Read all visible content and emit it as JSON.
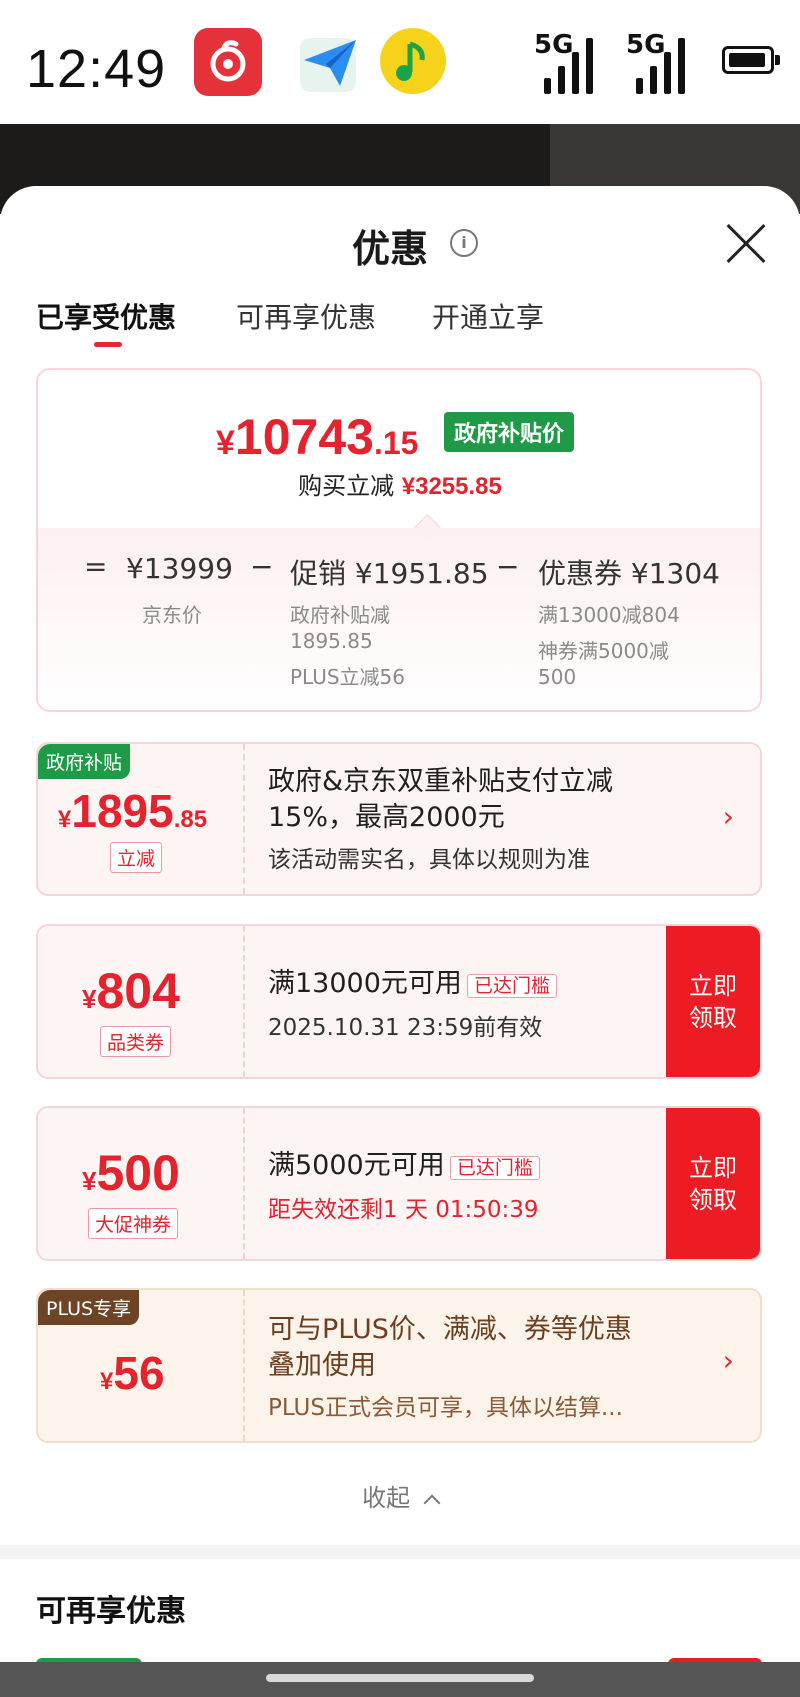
{
  "status_bar": {
    "time": "12:49",
    "network1": "5G",
    "network2": "5G"
  },
  "apps": [
    "netease-music-icon",
    "paper-plane-icon",
    "qq-music-icon"
  ],
  "sheet": {
    "title": "优惠",
    "tabs": [
      "已享受优惠",
      "可再享优惠",
      "开通立享"
    ],
    "active_tab": 0
  },
  "summary": {
    "yen": "¥",
    "price_int": "10743",
    "price_dec": ".15",
    "tag": "政府补贴价",
    "reduce_label": "购买立减",
    "reduce_amount": "¥3255.85",
    "eq": "=",
    "minus": "−",
    "jd_price": "¥13999",
    "jd_price_label": "京东价",
    "promo": "促销 ¥1951.85",
    "promo_detail1": "政府补贴减",
    "promo_detail2": "1895.85",
    "promo_detail3": "PLUS立减56",
    "coupon": "优惠券 ¥1304",
    "coupon_detail1": "满13000减804",
    "coupon_detail2": "神券满5000减",
    "coupon_detail3": "500"
  },
  "cards": [
    {
      "corner": "政府补贴",
      "yen": "¥",
      "amount": "1895",
      "amount_dec": ".85",
      "label": "立减",
      "line1": "政府&京东双重补贴支付立减",
      "line2": "15%，最高2000元",
      "line3": "该活动需实名，具体以规则为准"
    },
    {
      "yen": "¥",
      "amount": "804",
      "label": "品类券",
      "line1": "满13000元可用",
      "threshold": "已达门槛",
      "line2": "2025.10.31 23:59前有效",
      "cta": "立即领取"
    },
    {
      "yen": "¥",
      "amount": "500",
      "label": "大促神券",
      "line1": "满5000元可用",
      "threshold": "已达门槛",
      "line2": "距失效还剩1 天 01:50:39",
      "cta": "立即领取"
    },
    {
      "corner": "PLUS专享",
      "yen": "¥",
      "amount": "56",
      "line1": "可与PLUS价、满减、券等优惠",
      "line2": "叠加使用",
      "line3": "PLUS正式会员可享，具体以结算..."
    }
  ],
  "collapse_label": "收起",
  "section2_title": "可再享优惠",
  "colors": {
    "accent_red": "#e4232f",
    "cta_red": "#ed1c24",
    "green": "#1f9b48",
    "plus_brown": "#7a4d2c"
  }
}
